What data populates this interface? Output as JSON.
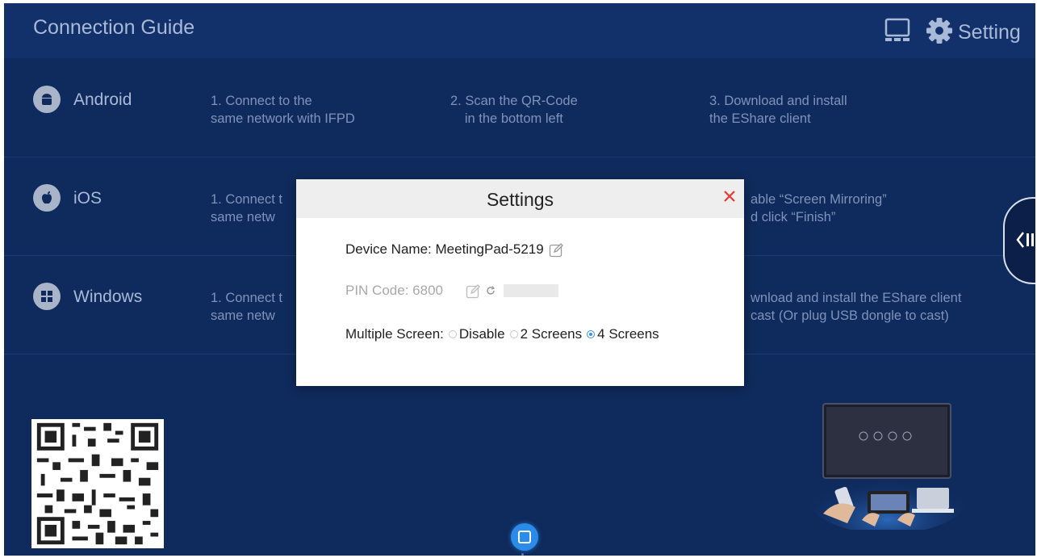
{
  "header": {
    "title": "Connection Guide",
    "setting_label": "Setting"
  },
  "guide": {
    "rows": [
      {
        "os": "Android",
        "icon": "android-icon",
        "steps": [
          "1. Connect to the\nsame network with IFPD",
          "2. Scan the QR-Code\nin the bottom left",
          "3. Download and install\nthe EShare client"
        ]
      },
      {
        "os": "iOS",
        "icon": "apple-icon",
        "steps": [
          "1. Connect t\nsame netw",
          "able “Screen Mirroring”\nd click “Finish”"
        ]
      },
      {
        "os": "Windows",
        "icon": "windows-icon",
        "steps": [
          "1. Connect t\nsame netw",
          "wnload and install the EShare client\ncast (Or plug USB dongle to cast)"
        ]
      }
    ]
  },
  "dialog": {
    "title": "Settings",
    "device_name_label": "Device Name:",
    "device_name_value": "MeetingPad-5219",
    "pin_label": "PIN Code:",
    "pin_value": "6800",
    "multiple_screen_label": "Multiple Screen:",
    "options": [
      "Disable",
      "2 Screens",
      "4 Screens"
    ],
    "selected_option": "4 Screens"
  },
  "colors": {
    "background": "#0f2a5c",
    "accent": "#2a8ce8",
    "close": "#e53935"
  }
}
